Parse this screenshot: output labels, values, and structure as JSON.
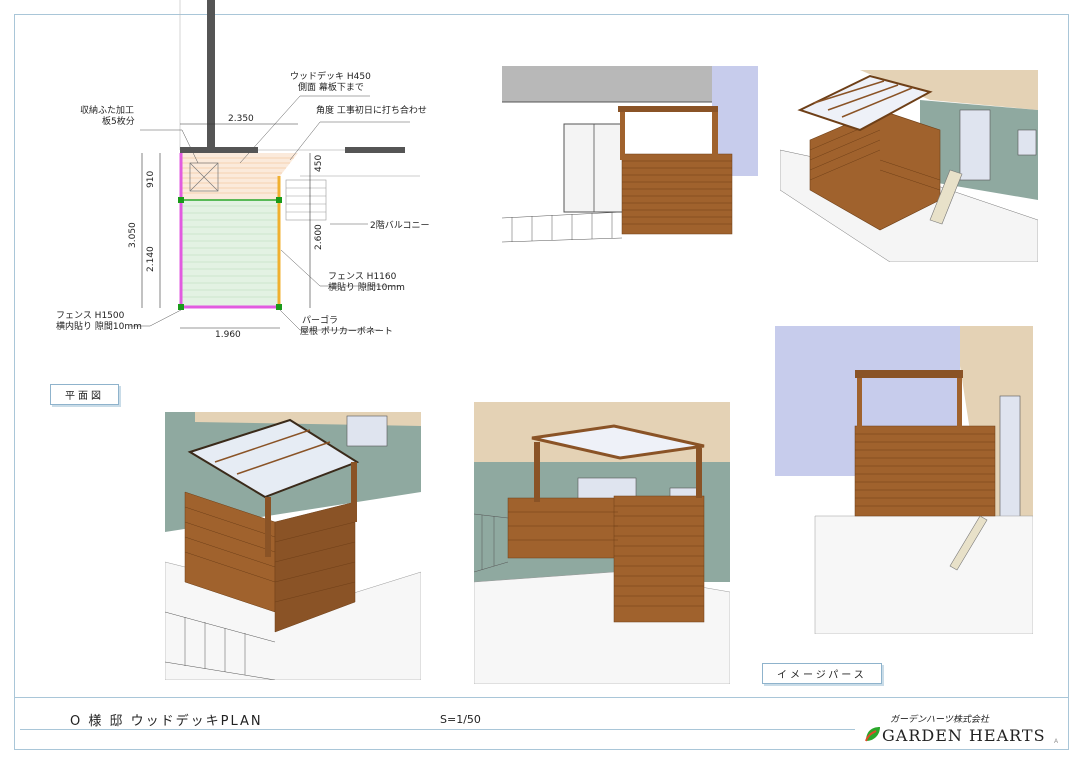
{
  "plan": {
    "labels": {
      "storage_lid": "収納ふた加工",
      "storage_lid_sub": "板5枚分",
      "deck": "ウッドデッキ H450",
      "deck_sub": "側面 幕板下まで",
      "angle_note": "角度 工事初日に打ち合わせ",
      "balcony": "2階バルコニー",
      "fence_right": "フェンス H1160",
      "fence_right_sub": "横貼り 隙間10mm",
      "fence_left": "フェンス H1500",
      "fence_left_sub": "横内貼り 隙間10mm",
      "pergola": "パーゴラ",
      "pergola_sub": "屋根 ポリカーボネート"
    },
    "dims": {
      "top_width": "2.350",
      "bottom_width": "1.960",
      "total_depth": "3.050",
      "upper_depth": "910",
      "lower_depth": "2.140",
      "right_upper": "450",
      "right_lower": "2.600"
    },
    "tag": "平面図"
  },
  "image_tag": "イメージパース",
  "title_block": {
    "sheet_title": "O 様 邸 ウッドデッキPLAN",
    "scale": "S=1/50",
    "company_jp": "ガーデンハーツ株式会社",
    "company_en": "GARDEN HEARTS",
    "mark": "A"
  },
  "colors": {
    "wood": "#a0622d",
    "wood_dark": "#6e3f17",
    "wall_green": "#8fa9a0",
    "siding": "#e4d2b5",
    "sky": "#c7ccec",
    "deck_green": "#2aa82a",
    "fence_magenta": "#e25be0",
    "fence_orange": "#f0b030"
  }
}
